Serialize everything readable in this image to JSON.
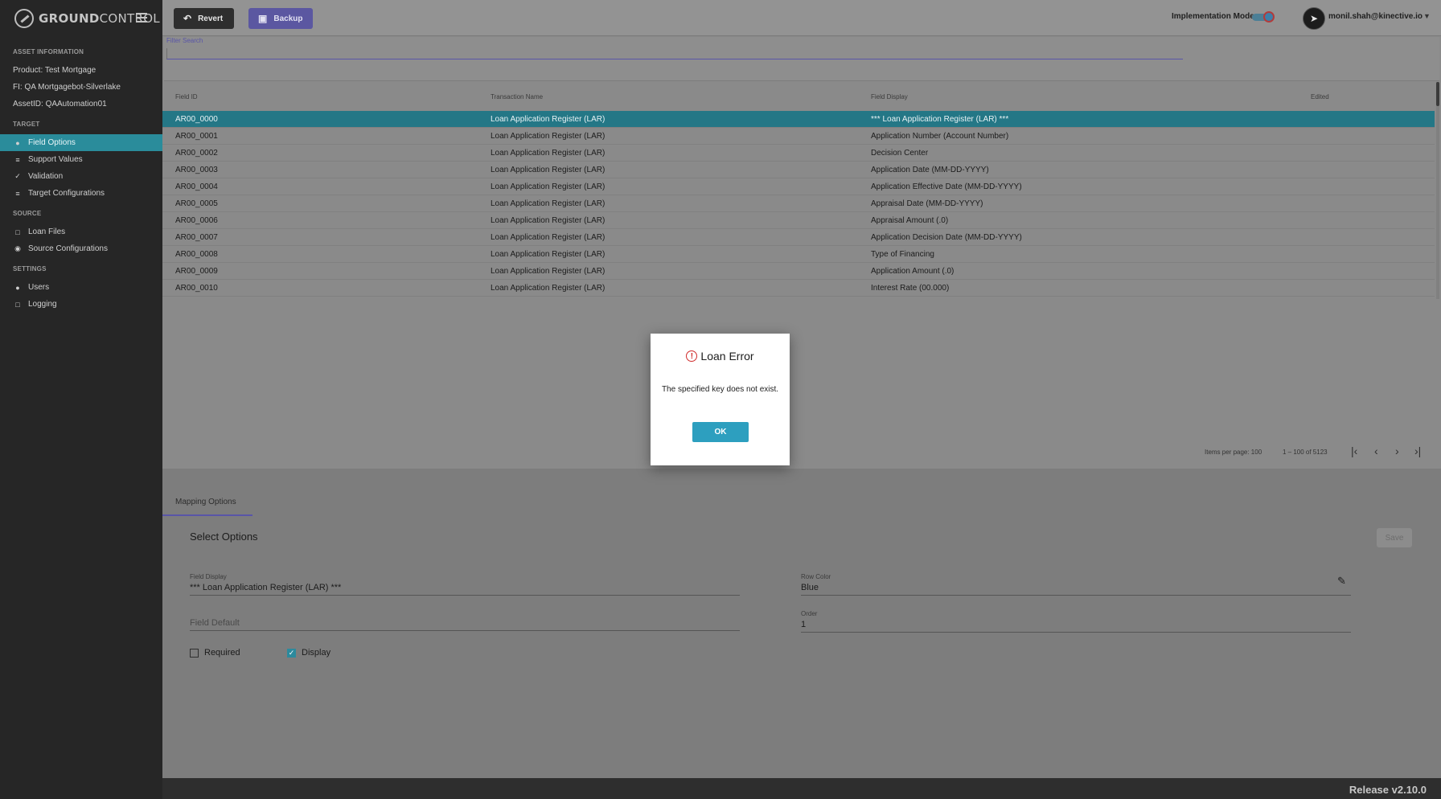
{
  "app": {
    "name_bold": "GROUND",
    "name_thin": "CONTROL"
  },
  "sidebar": {
    "asset_title": "ASSET INFORMATION",
    "product": "Product:  Test Mortgage",
    "fi": "FI:  QA Mortgagebot-Silverlake",
    "asset_id": "AssetID:  QAAutomation01",
    "target_title": "TARGET",
    "target_items": [
      "Field Options",
      "Support Values",
      "Validation",
      "Target Configurations"
    ],
    "source_title": "SOURCE",
    "source_items": [
      "Loan Files",
      "Source Configurations"
    ],
    "settings_title": "SETTINGS",
    "settings_items": [
      "Users",
      "Logging"
    ]
  },
  "toolbar": {
    "revert": "Revert",
    "backup": "Backup",
    "implementation_mode": "Implementation Mode",
    "user_email": "monil.shah@kinective.io"
  },
  "filter": {
    "label": "Filter Search",
    "value": ""
  },
  "table": {
    "headers": [
      "Field ID",
      "Transaction Name",
      "Field Display",
      "Edited"
    ],
    "rows": [
      [
        "AR00_0000",
        "Loan Application Register (LAR)",
        "*** Loan Application Register (LAR) ***"
      ],
      [
        "AR00_0001",
        "Loan Application Register (LAR)",
        "Application Number (Account Number)"
      ],
      [
        "AR00_0002",
        "Loan Application Register (LAR)",
        "Decision Center"
      ],
      [
        "AR00_0003",
        "Loan Application Register (LAR)",
        "Application Date (MM-DD-YYYY)"
      ],
      [
        "AR00_0004",
        "Loan Application Register (LAR)",
        "Application Effective Date (MM-DD-YYYY)"
      ],
      [
        "AR00_0005",
        "Loan Application Register (LAR)",
        "Appraisal Date (MM-DD-YYYY)"
      ],
      [
        "AR00_0006",
        "Loan Application Register (LAR)",
        "Appraisal Amount (.0)"
      ],
      [
        "AR00_0007",
        "Loan Application Register (LAR)",
        "Application Decision Date (MM-DD-YYYY)"
      ],
      [
        "AR00_0008",
        "Loan Application Register (LAR)",
        "Type of Financing"
      ],
      [
        "AR00_0009",
        "Loan Application Register (LAR)",
        "Application Amount (.0)"
      ],
      [
        "AR00_0010",
        "Loan Application Register (LAR)",
        "Interest Rate (00.000)"
      ]
    ]
  },
  "paginator": {
    "items_per_page": "Items per page:  100",
    "range": "1 – 100 of 5123"
  },
  "mapping": {
    "tab": "Mapping Options",
    "title": "Select Options",
    "save": "Save",
    "field_display_label": "Field Display",
    "field_display_value": "*** Loan Application Register (LAR) ***",
    "field_default_placeholder": "Field Default",
    "row_color_label": "Row Color",
    "row_color_value": "Blue",
    "order_label": "Order",
    "order_value": "1",
    "required": "Required",
    "display": "Display",
    "required_checked": false,
    "display_checked": true
  },
  "footer": {
    "release": "Release v2.10.0"
  },
  "modal": {
    "title": "Loan Error",
    "message": "The specified key does not exist.",
    "ok": "OK"
  },
  "colors": {
    "accent_teal": "#2a8c9b",
    "accent_purple": "#5b57a1",
    "error_red": "#d02b2b",
    "ok_blue": "#2d9fbf"
  }
}
